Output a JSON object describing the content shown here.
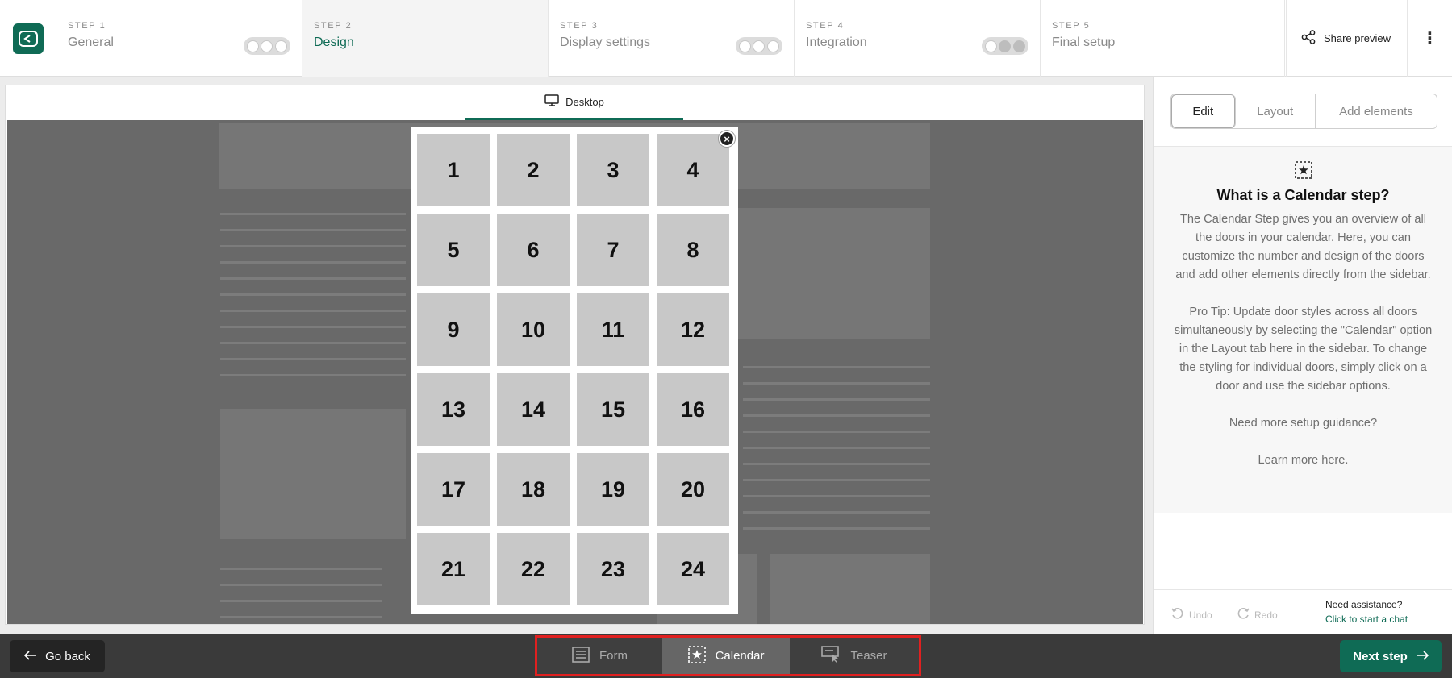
{
  "steps": [
    {
      "num": "STEP 1",
      "title": "General",
      "progress": "0 of 3"
    },
    {
      "num": "STEP 2",
      "title": "Design"
    },
    {
      "num": "STEP 3",
      "title": "Display settings",
      "progress": "0 of 3"
    },
    {
      "num": "STEP 4",
      "title": "Integration",
      "progress": "2 of 3"
    },
    {
      "num": "STEP 5",
      "title": "Final setup"
    }
  ],
  "header": {
    "share_label": "Share preview",
    "more_icon": "kebab-icon"
  },
  "preview": {
    "device_tab": "Desktop"
  },
  "calendar": {
    "doors": [
      "1",
      "2",
      "3",
      "4",
      "5",
      "6",
      "7",
      "8",
      "9",
      "10",
      "11",
      "12",
      "13",
      "14",
      "15",
      "16",
      "17",
      "18",
      "19",
      "20",
      "21",
      "22",
      "23",
      "24"
    ]
  },
  "sidebar": {
    "tabs": [
      "Edit",
      "Layout",
      "Add elements"
    ],
    "active_tab": "Edit",
    "info": {
      "title": "What is a Calendar step?",
      "paragraphs": [
        "The Calendar Step gives you an overview of all the doors in your calendar. Here, you can customize the number and design of the doors and add other elements directly from the sidebar.",
        "Pro Tip: Update door styles across all doors simultaneously by selecting the \"Calendar\" option in the Layout tab here in the sidebar. To change the styling for individual doors, simply click on a door and use the sidebar options.",
        "Need more setup guidance?",
        "Learn more here."
      ]
    },
    "footer": {
      "undo": "Undo",
      "redo": "Redo",
      "assist_title": "Need assistance?",
      "assist_link": "Click to start a chat"
    }
  },
  "bottom": {
    "go_back": "Go back",
    "tabs": [
      "Form",
      "Calendar",
      "Teaser"
    ],
    "active_tab": "Calendar",
    "next_step": "Next step"
  },
  "colors": {
    "accent": "#0f6b55",
    "highlight_border": "#e02020"
  }
}
